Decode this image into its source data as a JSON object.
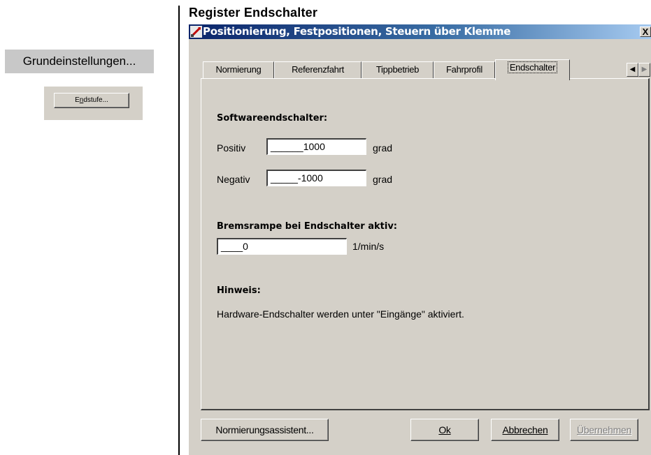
{
  "left_panel": {
    "grund_button": "Grundeinstellungen...",
    "endstufe_button": "Endstufe..."
  },
  "heading": "Register Endschalter",
  "dialog": {
    "title": "Positionierung, Festpositionen, Steuern über Klemme",
    "close_label": "X",
    "tabs": [
      {
        "label": "Normierung"
      },
      {
        "label": "Referenzfahrt"
      },
      {
        "label": "Tippbetrieb"
      },
      {
        "label": "Fahrprofil"
      },
      {
        "label": "Endschalter",
        "active": true
      }
    ],
    "tab_scroll_left": "◀",
    "tab_scroll_right": "▶",
    "software_section": {
      "title": "Softwareendschalter:",
      "positiv_label": "Positiv",
      "positiv_value": "______1000",
      "positiv_unit": "grad",
      "negativ_label": "Negativ",
      "negativ_value": "_____-1000",
      "negativ_unit": "grad"
    },
    "brems_section": {
      "title": "Bremsrampe bei Endschalter aktiv:",
      "value": "____0",
      "unit": "1/min/s"
    },
    "hinweis": {
      "title": "Hinweis:",
      "text": "Hardware-Endschalter werden unter \"Eingänge\" aktiviert."
    },
    "buttons": {
      "assistent": "Normierungsassistent...",
      "ok": "Ok",
      "abbrechen": "Abbrechen",
      "uebernehmen": "Übernehmen"
    }
  }
}
